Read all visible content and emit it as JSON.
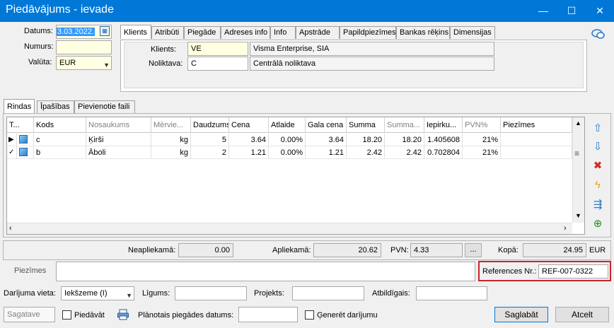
{
  "window": {
    "title": "Piedāvājums - ievade",
    "minimize": "—",
    "maximize": "☐",
    "close": "✕"
  },
  "header": {
    "datums_label": "Datums:",
    "datums_value": "3.03.2022.",
    "numurs_label": "Numurs:",
    "numurs_value": "",
    "valuta_label": "Valūta:",
    "valuta_value": "EUR"
  },
  "top_tabs": [
    "Klients",
    "Atribūti",
    "Piegāde",
    "Adreses info",
    "Info",
    "Apstrāde",
    "Papildpiezīmes",
    "Bankas rēķins",
    "Dimensijas"
  ],
  "client": {
    "klients_label": "Klients:",
    "klients_code": "VE",
    "klients_name": "Visma Enterprise, SIA",
    "noliktava_label": "Noliktava:",
    "noliktava_code": "C",
    "noliktava_name": "Centrālā noliktava"
  },
  "lower_tabs": [
    "Rindas",
    "Īpašības",
    "Pievienotie faili"
  ],
  "grid": {
    "columns": [
      "T...",
      "Kods",
      "Nosaukums",
      "Mērvie...",
      "Daudzums",
      "Cena",
      "Atlaide",
      "Gala cena",
      "Summa",
      "Summa...",
      "Iepirku...",
      "PVN%",
      "Piezīmes"
    ],
    "rows": [
      {
        "indicator": "▶",
        "kods": "c",
        "nosaukums": "Ķirši",
        "mervieniba": "kg",
        "daudzums": "5",
        "cena": "3.64",
        "atlaide": "0.00%",
        "gala_cena": "3.64",
        "summa": "18.20",
        "summa2": "18.20",
        "iepirku": "1.405608",
        "pvn": "21%",
        "piezimes": ""
      },
      {
        "indicator": "✓",
        "kods": "b",
        "nosaukums": "Āboli",
        "mervieniba": "kg",
        "daudzums": "2",
        "cena": "1.21",
        "atlaide": "0.00%",
        "gala_cena": "1.21",
        "summa": "2.42",
        "summa2": "2.42",
        "iepirku": "0.702804",
        "pvn": "21%",
        "piezimes": ""
      }
    ]
  },
  "side_icons": [
    "arrow-up-icon",
    "arrow-down-icon",
    "delete-icon",
    "lightning-icon",
    "import-icon",
    "add-icon"
  ],
  "totals": {
    "neapliekama_label": "Neapliekamā:",
    "neapliekama_value": "0.00",
    "apliekama_label": "Apliekamā:",
    "apliekama_value": "20.62",
    "pvn_label": "PVN:",
    "pvn_value": "4.33",
    "pvn_button": "...",
    "kopa_label": "Kopā:",
    "kopa_value": "24.95",
    "currency": "EUR"
  },
  "notes": {
    "piezimes_label": "Piezīmes",
    "references_label": "References Nr.:",
    "references_value": "REF-007-0322"
  },
  "deal": {
    "vieta_label": "Darījuma vieta:",
    "vieta_value": "Iekšzeme (I)",
    "ligums_label": "Līgums:",
    "projekts_label": "Projekts:",
    "atbildigais_label": "Atbildīgais:"
  },
  "footer": {
    "status": "Sagatave",
    "piedavat_label": "Piedāvāt",
    "planotais_label": "Plānotais piegādes datums:",
    "generet_label": "Ģenerēt darījumu",
    "save_label": "Saglabāt",
    "cancel_label": "Atcelt"
  },
  "colors": {
    "titlebar": "#0078d7",
    "highlight_border": "#c8262c",
    "selected_date_bg": "#3399ff"
  }
}
